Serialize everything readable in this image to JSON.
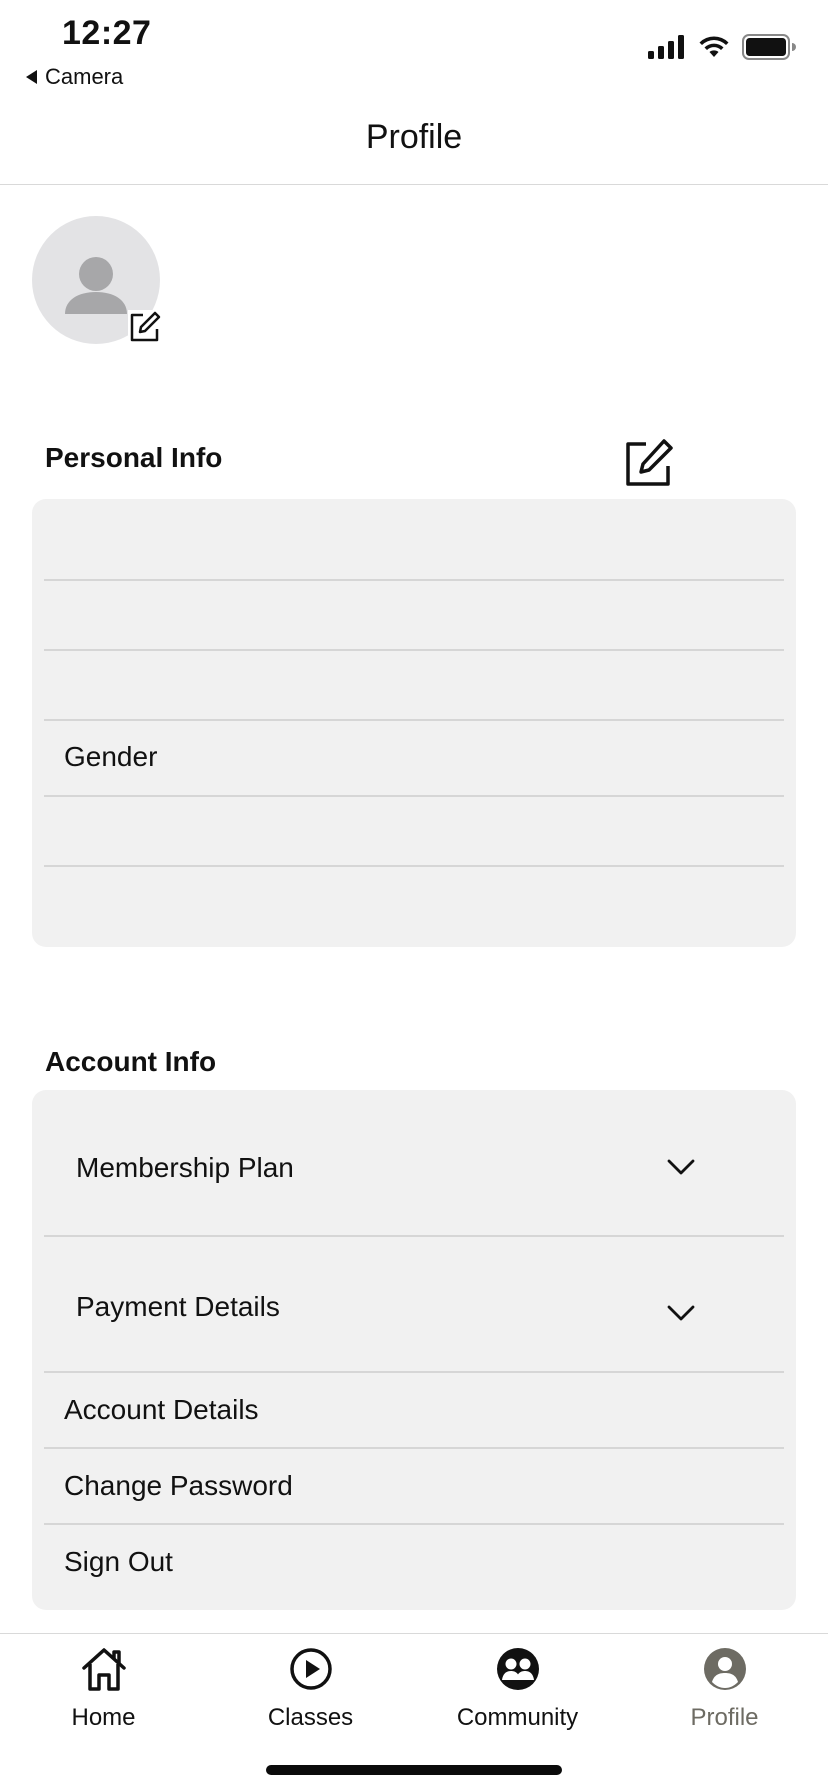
{
  "status_bar": {
    "time": "12:27",
    "back_label": "Camera"
  },
  "header": {
    "title": "Profile"
  },
  "personal_info": {
    "title": "Personal Info",
    "rows": [
      "",
      "",
      "",
      "Gender",
      "",
      ""
    ]
  },
  "account_info": {
    "title": "Account Info",
    "membership_plan": "Membership Plan",
    "payment_details": "Payment Details",
    "account_details": "Account Details",
    "change_password": "Change Password",
    "sign_out": "Sign Out"
  },
  "tab_bar": {
    "items": [
      {
        "label": "Home",
        "icon": "home-icon"
      },
      {
        "label": "Classes",
        "icon": "play-circle-icon"
      },
      {
        "label": "Community",
        "icon": "community-icon"
      },
      {
        "label": "Profile",
        "icon": "profile-icon"
      }
    ],
    "active": "Profile"
  },
  "colors": {
    "background": "#ffffff",
    "card": "#f1f1f1",
    "divider": "#d6d6d6",
    "active_tab": "#6d6b63"
  }
}
